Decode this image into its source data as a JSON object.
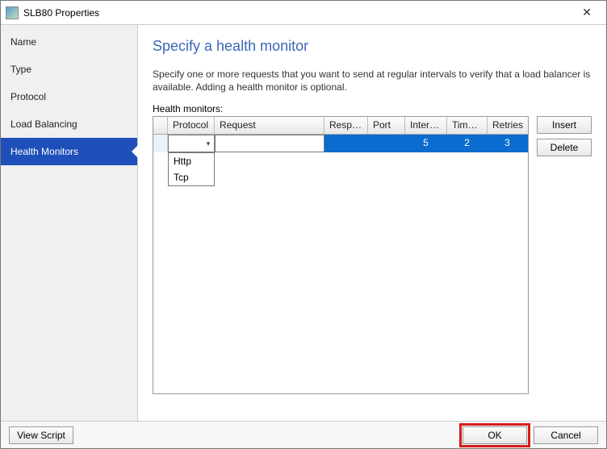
{
  "window": {
    "title": "SLB80 Properties"
  },
  "sidebar": {
    "items": [
      {
        "label": "Name"
      },
      {
        "label": "Type"
      },
      {
        "label": "Protocol"
      },
      {
        "label": "Load Balancing"
      },
      {
        "label": "Health Monitors",
        "selected": true
      }
    ]
  },
  "main": {
    "heading": "Specify a health monitor",
    "description": "Specify one or more requests that you want to send at regular intervals to verify that a load balancer is available. Adding a health monitor is optional.",
    "grid_label": "Health monitors:",
    "columns": {
      "protocol": "Protocol",
      "request": "Request",
      "response": "Respo...",
      "port": "Port",
      "interval": "Interval",
      "timeout": "Time-...",
      "retries": "Retries"
    },
    "row": {
      "protocol": "",
      "request": "",
      "response": "",
      "port": "",
      "interval": "5",
      "timeout": "2",
      "retries": "3"
    },
    "protocol_options": [
      "Http",
      "Tcp"
    ],
    "buttons": {
      "insert": "Insert",
      "delete": "Delete"
    }
  },
  "footer": {
    "view_script": "View Script",
    "ok": "OK",
    "cancel": "Cancel"
  }
}
